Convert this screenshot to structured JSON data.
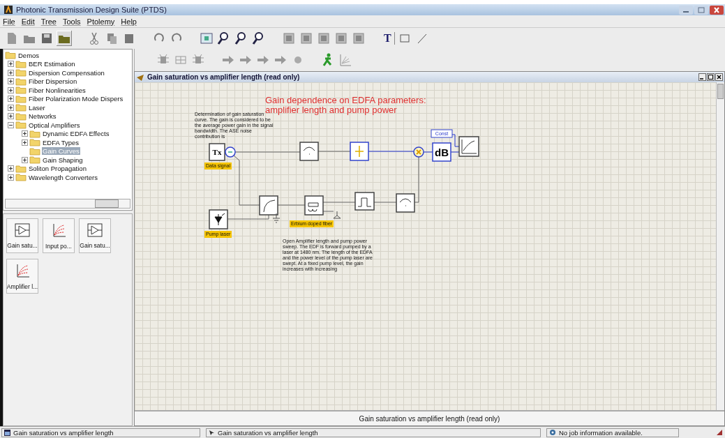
{
  "window": {
    "title": "Photonic Transmission Design Suite (PTDS)"
  },
  "menu": [
    "File",
    "Edit",
    "Tree",
    "Tools",
    "Ptolemy",
    "Help"
  ],
  "toolbar": {
    "text_tool": "T"
  },
  "tree": [
    {
      "label": "Demos",
      "children": [
        {
          "label": "BER Estimation",
          "expanded": false,
          "selected": false
        },
        {
          "label": "Dispersion Compensation",
          "expanded": false,
          "selected": false
        },
        {
          "label": "Fiber Dispersion",
          "expanded": false,
          "selected": false
        },
        {
          "label": "Fiber Nonlinearities",
          "expanded": false,
          "selected": false
        },
        {
          "label": "Fiber Polarization Mode Dispers",
          "expanded": false,
          "selected": false
        },
        {
          "label": "Laser",
          "expanded": false,
          "selected": false
        },
        {
          "label": "Networks",
          "expanded": false,
          "selected": false
        },
        {
          "label": "Optical Amplifiers",
          "expanded": true,
          "selected": false,
          "children": [
            {
              "label": "Dynamic EDFA Effects",
              "expanded": false,
              "selected": false
            },
            {
              "label": "EDFA Types",
              "expanded": false,
              "selected": false
            },
            {
              "label": "Gain Curves",
              "selected": true
            },
            {
              "label": "Gain Shaping",
              "expanded": false,
              "selected": false
            }
          ]
        },
        {
          "label": "Soliton Propagation",
          "expanded": false,
          "selected": false
        },
        {
          "label": "Wavelength Converters",
          "expanded": false,
          "selected": false
        }
      ]
    }
  ],
  "palette": [
    {
      "label": "Gain satu...",
      "kind": "amplifier"
    },
    {
      "label": "Input po...",
      "kind": "plot"
    },
    {
      "label": "Gain satu...",
      "kind": "amplifier"
    },
    {
      "label": "Amplifier l...",
      "kind": "plot"
    }
  ],
  "document": {
    "title": "Gain saturation vs amplifier length (read only)",
    "heading": [
      "Gain dependence on EDFA parameters:",
      "amplifier length and pump power"
    ],
    "notes": [
      "Determination of gain saturation curve. The gain is considered to be the average power gain in the signal bandwidth. The ASE noise contribution is",
      "Open Amplifier length and pump power sweep. The EDF is forward pumped by a laser at 1480 nm. The length of the EDFA and the power level of the pump laser are swept. At a fixed pump level, the gain increases with increasing"
    ],
    "blocks": [
      {
        "kind": "source",
        "label": "Tx"
      },
      {
        "kind": "splitter"
      },
      {
        "kind": "arc"
      },
      {
        "kind": "filter"
      },
      {
        "kind": "mixer"
      },
      {
        "kind": "const",
        "label": "Const"
      },
      {
        "kind": "db",
        "label": "dB"
      },
      {
        "kind": "scope"
      },
      {
        "kind": "coupler"
      },
      {
        "kind": "fiber"
      },
      {
        "kind": "bandpass"
      },
      {
        "kind": "arc"
      },
      {
        "kind": "pump"
      }
    ],
    "tags": [
      "Data signal",
      "Pump laser",
      "Erbium doped fiber"
    ],
    "footer": "Gain saturation vs amplifier length (read only)"
  },
  "status_bar": [
    "Gain saturation vs amplifier length",
    "Gain saturation vs amplifier length",
    "No job information available."
  ]
}
